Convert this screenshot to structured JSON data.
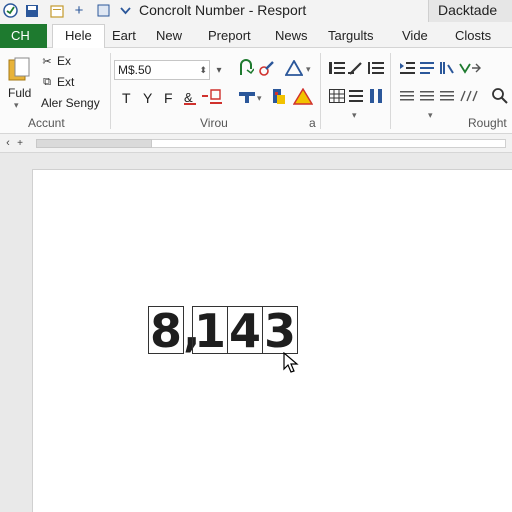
{
  "titlebar": {
    "title": "Concrolt Number - Resport",
    "account": "Dacktade",
    "quick_access": [
      "save-icon",
      "folder-icon",
      "add-icon",
      "window-icon",
      "customize-icon"
    ]
  },
  "tabs": {
    "file": "CH",
    "items": [
      "Hele",
      "Eart",
      "New",
      "Preport",
      "News",
      "Targults",
      "Vide",
      "Closts"
    ],
    "active_index": 0
  },
  "ribbon": {
    "clipboard": {
      "paste_label": "Fuld",
      "cut_label": "Ex",
      "copy_label": "Ext",
      "format_label": "Aler Sengy",
      "group_label": "Accunt"
    },
    "font": {
      "font_name": "M$.50",
      "letters": [
        "T",
        "Y",
        "F"
      ],
      "group_label": "Virou"
    },
    "paragraph": {
      "group_label": "a"
    },
    "editing": {
      "group_label": "Rought"
    },
    "colors": {
      "accent_blue": "#2b579a",
      "green": "#1e7a2f",
      "red": "#d0312d",
      "yellow": "#f2c200"
    }
  },
  "document": {
    "digits": [
      "8",
      "1",
      "4",
      "3"
    ],
    "separator": ",",
    "value_text": "8,143"
  }
}
